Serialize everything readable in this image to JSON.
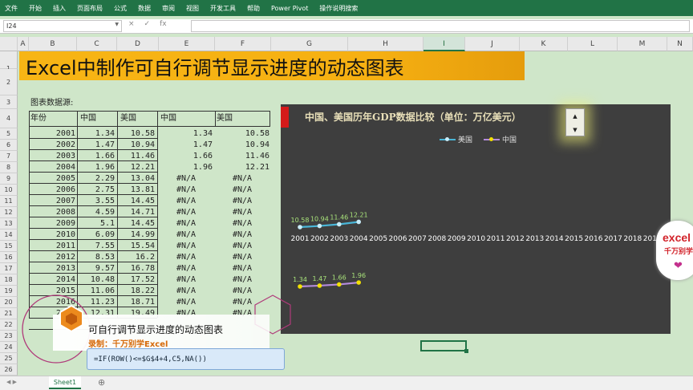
{
  "ribbon_tabs": [
    "文件",
    "开始",
    "插入",
    "页面布局",
    "公式",
    "数据",
    "审阅",
    "视图",
    "开发工具",
    "帮助",
    "Power Pivot",
    "操作说明搜索"
  ],
  "name_box": "I24",
  "formula_icons": [
    "×",
    "✓",
    "fx"
  ],
  "columns": [
    "A",
    "B",
    "C",
    "D",
    "E",
    "F",
    "G",
    "H",
    "I",
    "J",
    "K",
    "L",
    "M",
    "N"
  ],
  "selected_column": "I",
  "rows": [
    "1",
    "2",
    "3",
    "4",
    "5",
    "6",
    "7",
    "8",
    "9",
    "10",
    "11",
    "12",
    "13",
    "14",
    "15",
    "16",
    "17",
    "18",
    "19",
    "20",
    "21",
    "22",
    "23",
    "24",
    "25",
    "26"
  ],
  "title": "Excel中制作可自行调节显示进度的动态图表",
  "table_caption": "图表数据源:",
  "headers": [
    "年份",
    "中国",
    "美国",
    "中国",
    "美国"
  ],
  "table": [
    [
      "2001",
      "1.34",
      "10.58",
      "1.34",
      "10.58"
    ],
    [
      "2002",
      "1.47",
      "10.94",
      "1.47",
      "10.94"
    ],
    [
      "2003",
      "1.66",
      "11.46",
      "1.66",
      "11.46"
    ],
    [
      "2004",
      "1.96",
      "12.21",
      "1.96",
      "12.21"
    ],
    [
      "2005",
      "2.29",
      "13.04",
      "#N/A",
      "#N/A"
    ],
    [
      "2006",
      "2.75",
      "13.81",
      "#N/A",
      "#N/A"
    ],
    [
      "2007",
      "3.55",
      "14.45",
      "#N/A",
      "#N/A"
    ],
    [
      "2008",
      "4.59",
      "14.71",
      "#N/A",
      "#N/A"
    ],
    [
      "2009",
      "5.1",
      "14.45",
      "#N/A",
      "#N/A"
    ],
    [
      "2010",
      "6.09",
      "14.99",
      "#N/A",
      "#N/A"
    ],
    [
      "2011",
      "7.55",
      "15.54",
      "#N/A",
      "#N/A"
    ],
    [
      "2012",
      "8.53",
      "16.2",
      "#N/A",
      "#N/A"
    ],
    [
      "2013",
      "9.57",
      "16.78",
      "#N/A",
      "#N/A"
    ],
    [
      "2014",
      "10.48",
      "17.52",
      "#N/A",
      "#N/A"
    ],
    [
      "2015",
      "11.06",
      "18.22",
      "#N/A",
      "#N/A"
    ],
    [
      "2016",
      "11.23",
      "18.71",
      "#N/A",
      "#N/A"
    ],
    [
      "2017",
      "12.31",
      "19.49",
      "#N/A",
      "#N/A"
    ]
  ],
  "chart_data": {
    "type": "line",
    "title": "中国、美国历年GDP数据比较（单位：万亿美元）",
    "categories": [
      "2001",
      "2002",
      "2003",
      "2004",
      "2005",
      "2006",
      "2007",
      "2008",
      "2009",
      "2010",
      "2011",
      "2012",
      "2013",
      "2014",
      "2015",
      "2016",
      "2017",
      "2018",
      "2019"
    ],
    "series": [
      {
        "name": "中国",
        "color": "#f2e000",
        "line": "#b48bdc",
        "values": [
          1.34,
          1.47,
          1.66,
          1.96
        ]
      },
      {
        "name": "美国",
        "color": "#c8ecf8",
        "line": "#49b6d8",
        "values": [
          10.58,
          10.94,
          11.46,
          12.21
        ]
      }
    ],
    "label_color": "#a8e27a",
    "grid": false
  },
  "spinner": {
    "up": "▲",
    "down": "▼"
  },
  "overlay": {
    "line1": "可自行调节显示进度的动态图表",
    "line2": "录制：千万别学Excel"
  },
  "formula_tip": "=IF(ROW()<=$G$4+4,C5,NA())",
  "logo": {
    "line1": "excel",
    "line2": "千万别学"
  },
  "sheet_tab": "Sheet1",
  "colors": {
    "ribbon": "#217346",
    "title_bg": "#f7b515",
    "chart_bg": "#3e3e3e",
    "sheet_bg": "#cfe6c9"
  }
}
